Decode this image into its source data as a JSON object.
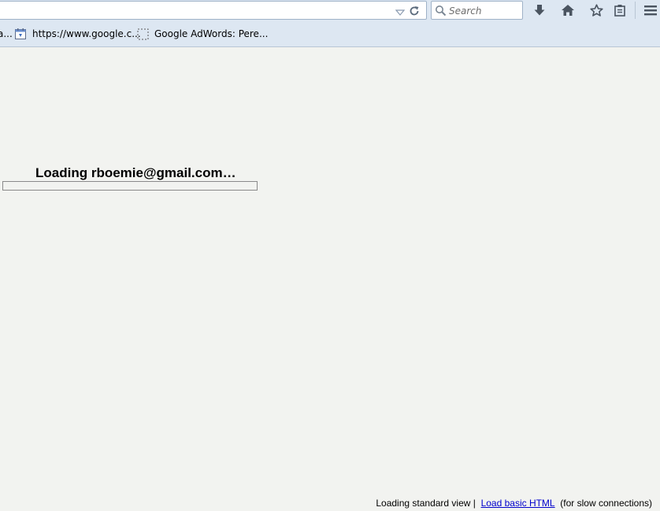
{
  "browser": {
    "search_placeholder": "Search",
    "toolbar_icons": [
      "download-icon",
      "home-icon",
      "star-icon",
      "reading-list-icon",
      "menu-icon"
    ],
    "bookmarks": [
      {
        "label": "a...",
        "icon": "page-icon"
      },
      {
        "label": "https://www.google.c...",
        "icon": "calendar-icon"
      },
      {
        "label": "Google AdWords: Pere...",
        "icon": "dashed-page-icon"
      }
    ]
  },
  "page": {
    "loading_title": "Loading rboemie@gmail.com…",
    "progress": 0,
    "footer": {
      "prefix": "Loading standard view |",
      "link_label": "Load basic HTML",
      "suffix": "(for slow connections)"
    },
    "colors": {
      "background": "#f2f3f0",
      "toolbar": "#dde7f2",
      "link": "#0000cc",
      "progress_fill": "#4d90fe"
    }
  }
}
